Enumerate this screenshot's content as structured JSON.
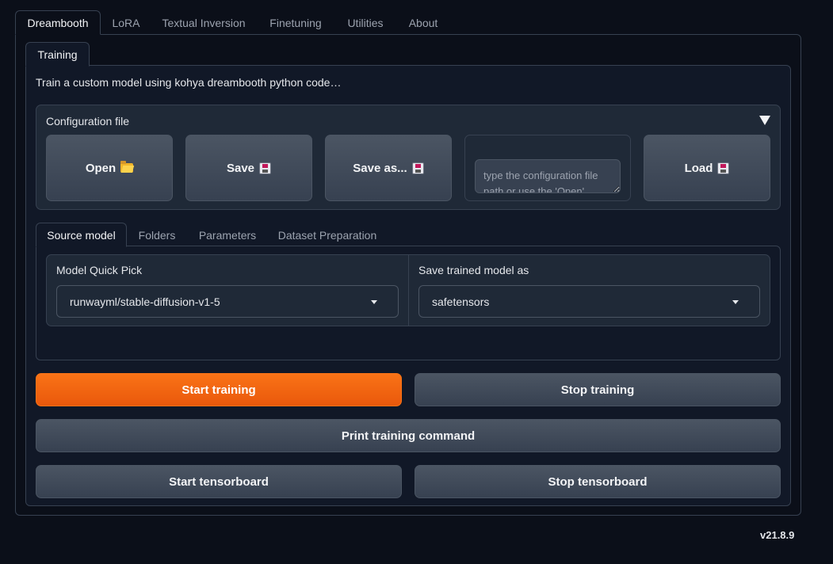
{
  "top_tabs": [
    "Dreambooth",
    "LoRA",
    "Textual Inversion",
    "Finetuning",
    "Utilities",
    "About"
  ],
  "inner_tab": "Training",
  "description": "Train a custom model using kohya dreambooth python code…",
  "config": {
    "label": "Configuration file",
    "open_label": "Open",
    "save_label": "Save",
    "save_as_label": "Save as...",
    "load_label": "Load",
    "path_placeholder": "type the configuration file path or use the 'Open' button above to select it..."
  },
  "sub_tabs": [
    "Source model",
    "Folders",
    "Parameters",
    "Dataset Preparation"
  ],
  "source_model": {
    "quick_pick_label": "Model Quick Pick",
    "quick_pick_value": "runwayml/stable-diffusion-v1-5",
    "save_as_label": "Save trained model as",
    "save_as_value": "safetensors"
  },
  "actions": {
    "start_training": "Start training",
    "stop_training": "Stop training",
    "print_command": "Print training command",
    "start_tensorboard": "Start tensorboard",
    "stop_tensorboard": "Stop tensorboard"
  },
  "version": "v21.8.9",
  "colors": {
    "primary": "#f97316",
    "background": "#0b0f19"
  }
}
